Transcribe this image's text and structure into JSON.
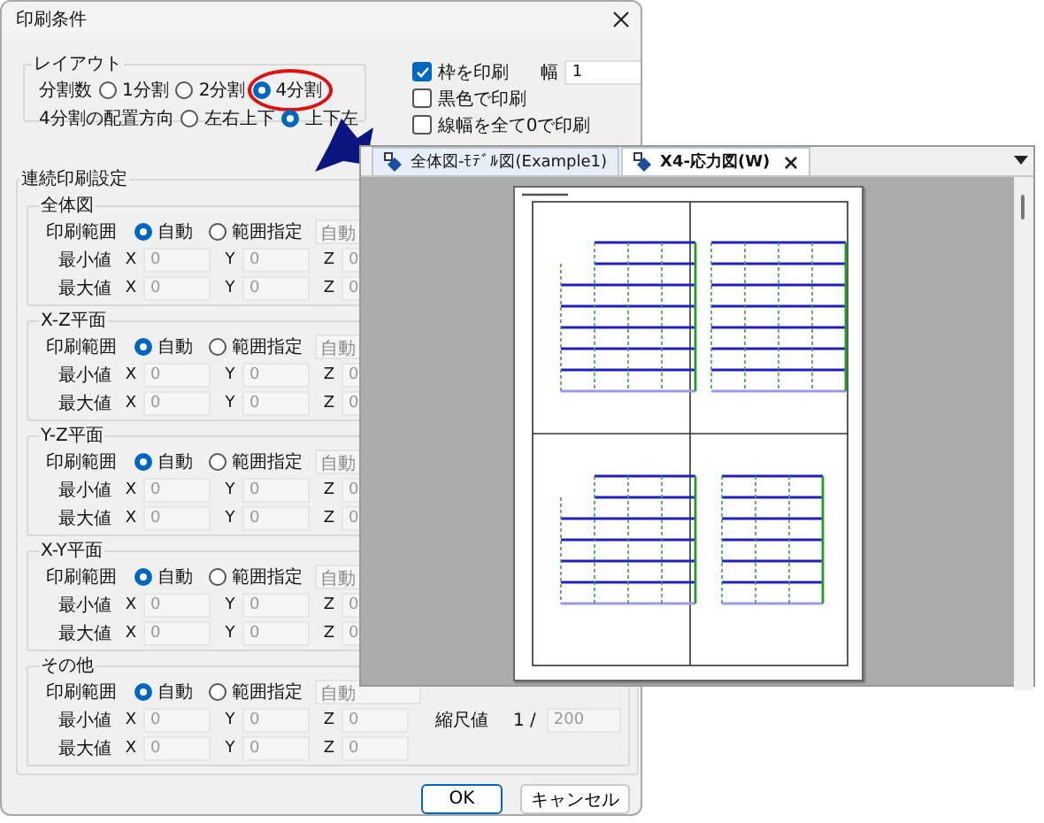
{
  "dialog": {
    "title": "印刷条件"
  },
  "layout": {
    "legend": "レイアウト",
    "rows": [
      {
        "label": "分割数",
        "options": [
          {
            "label": "1分割",
            "selected": false,
            "annotated": false
          },
          {
            "label": "2分割",
            "selected": false,
            "annotated": false
          },
          {
            "label": "4分割",
            "selected": true,
            "annotated": true
          }
        ]
      },
      {
        "label": "4分割の配置方向",
        "options": [
          {
            "label": "左右上下",
            "selected": false,
            "annotated": false
          },
          {
            "label": "上下左",
            "selected": true,
            "annotated": false
          }
        ]
      }
    ]
  },
  "print_options": [
    {
      "label": "枠を印刷",
      "checked": true,
      "width_label": "幅",
      "width_value": "1"
    },
    {
      "label": "黒色で印刷",
      "checked": false
    },
    {
      "label": "線幅を全て0で印刷",
      "checked": false
    }
  ],
  "continuous": {
    "legend": "連続印刷設定",
    "groups": [
      {
        "title": "全体図",
        "range_label": "印刷範囲",
        "modes": [
          {
            "label": "自動",
            "selected": true
          },
          {
            "label": "範囲指定",
            "selected": false
          }
        ],
        "auto_button": "自動",
        "rows": [
          {
            "label": "最小値",
            "fields": [
              {
                "axis": "X",
                "value": "0"
              },
              {
                "axis": "Y",
                "value": "0"
              },
              {
                "axis": "Z",
                "value": "0"
              }
            ]
          },
          {
            "label": "最大値",
            "fields": [
              {
                "axis": "X",
                "value": "0"
              },
              {
                "axis": "Y",
                "value": "0"
              },
              {
                "axis": "Z",
                "value": "0"
              }
            ]
          }
        ]
      },
      {
        "title": "X-Z平面",
        "range_label": "印刷範囲",
        "modes": [
          {
            "label": "自動",
            "selected": true
          },
          {
            "label": "範囲指定",
            "selected": false
          }
        ],
        "auto_button": "自動",
        "rows": [
          {
            "label": "最小値",
            "fields": [
              {
                "axis": "X",
                "value": "0"
              },
              {
                "axis": "Y",
                "value": "0"
              },
              {
                "axis": "Z",
                "value": "0"
              }
            ]
          },
          {
            "label": "最大値",
            "fields": [
              {
                "axis": "X",
                "value": "0"
              },
              {
                "axis": "Y",
                "value": "0"
              },
              {
                "axis": "Z",
                "value": "0"
              }
            ]
          }
        ]
      },
      {
        "title": "Y-Z平面",
        "range_label": "印刷範囲",
        "modes": [
          {
            "label": "自動",
            "selected": true
          },
          {
            "label": "範囲指定",
            "selected": false
          }
        ],
        "auto_button": "自動",
        "rows": [
          {
            "label": "最小値",
            "fields": [
              {
                "axis": "X",
                "value": "0"
              },
              {
                "axis": "Y",
                "value": "0"
              },
              {
                "axis": "Z",
                "value": "0"
              }
            ]
          },
          {
            "label": "最大値",
            "fields": [
              {
                "axis": "X",
                "value": "0"
              },
              {
                "axis": "Y",
                "value": "0"
              },
              {
                "axis": "Z",
                "value": "0"
              }
            ]
          }
        ]
      },
      {
        "title": "X-Y平面",
        "range_label": "印刷範囲",
        "modes": [
          {
            "label": "自動",
            "selected": true
          },
          {
            "label": "範囲指定",
            "selected": false
          }
        ],
        "auto_button": "自動",
        "rows": [
          {
            "label": "最小値",
            "fields": [
              {
                "axis": "X",
                "value": "0"
              },
              {
                "axis": "Y",
                "value": "0"
              },
              {
                "axis": "Z",
                "value": "0"
              }
            ]
          },
          {
            "label": "最大値",
            "fields": [
              {
                "axis": "X",
                "value": "0"
              },
              {
                "axis": "Y",
                "value": "0"
              },
              {
                "axis": "Z",
                "value": "0"
              }
            ]
          }
        ]
      },
      {
        "title": "その他",
        "range_label": "印刷範囲",
        "modes": [
          {
            "label": "自動",
            "selected": true
          },
          {
            "label": "範囲指定",
            "selected": false
          }
        ],
        "auto_button": "自動",
        "rows": [
          {
            "label": "最小値",
            "fields": [
              {
                "axis": "X",
                "value": "0"
              },
              {
                "axis": "Y",
                "value": "0"
              },
              {
                "axis": "Z",
                "value": "0"
              }
            ],
            "scale": {
              "label": "縮尺値",
              "prefix": "1 /",
              "value": "200"
            }
          },
          {
            "label": "最大値",
            "fields": [
              {
                "axis": "X",
                "value": "0"
              },
              {
                "axis": "Y",
                "value": "0"
              },
              {
                "axis": "Z",
                "value": "0"
              }
            ]
          }
        ]
      }
    ]
  },
  "buttons": [
    {
      "label": "OK",
      "default": true
    },
    {
      "label": "キャンセル",
      "default": false
    }
  ],
  "preview": {
    "tabs": [
      {
        "label": "全体図-ﾓﾃﾞﾙ図(Example1)",
        "selected": false,
        "closable": false
      },
      {
        "label": "X4-応力図(W)",
        "selected": true,
        "closable": true
      }
    ]
  }
}
